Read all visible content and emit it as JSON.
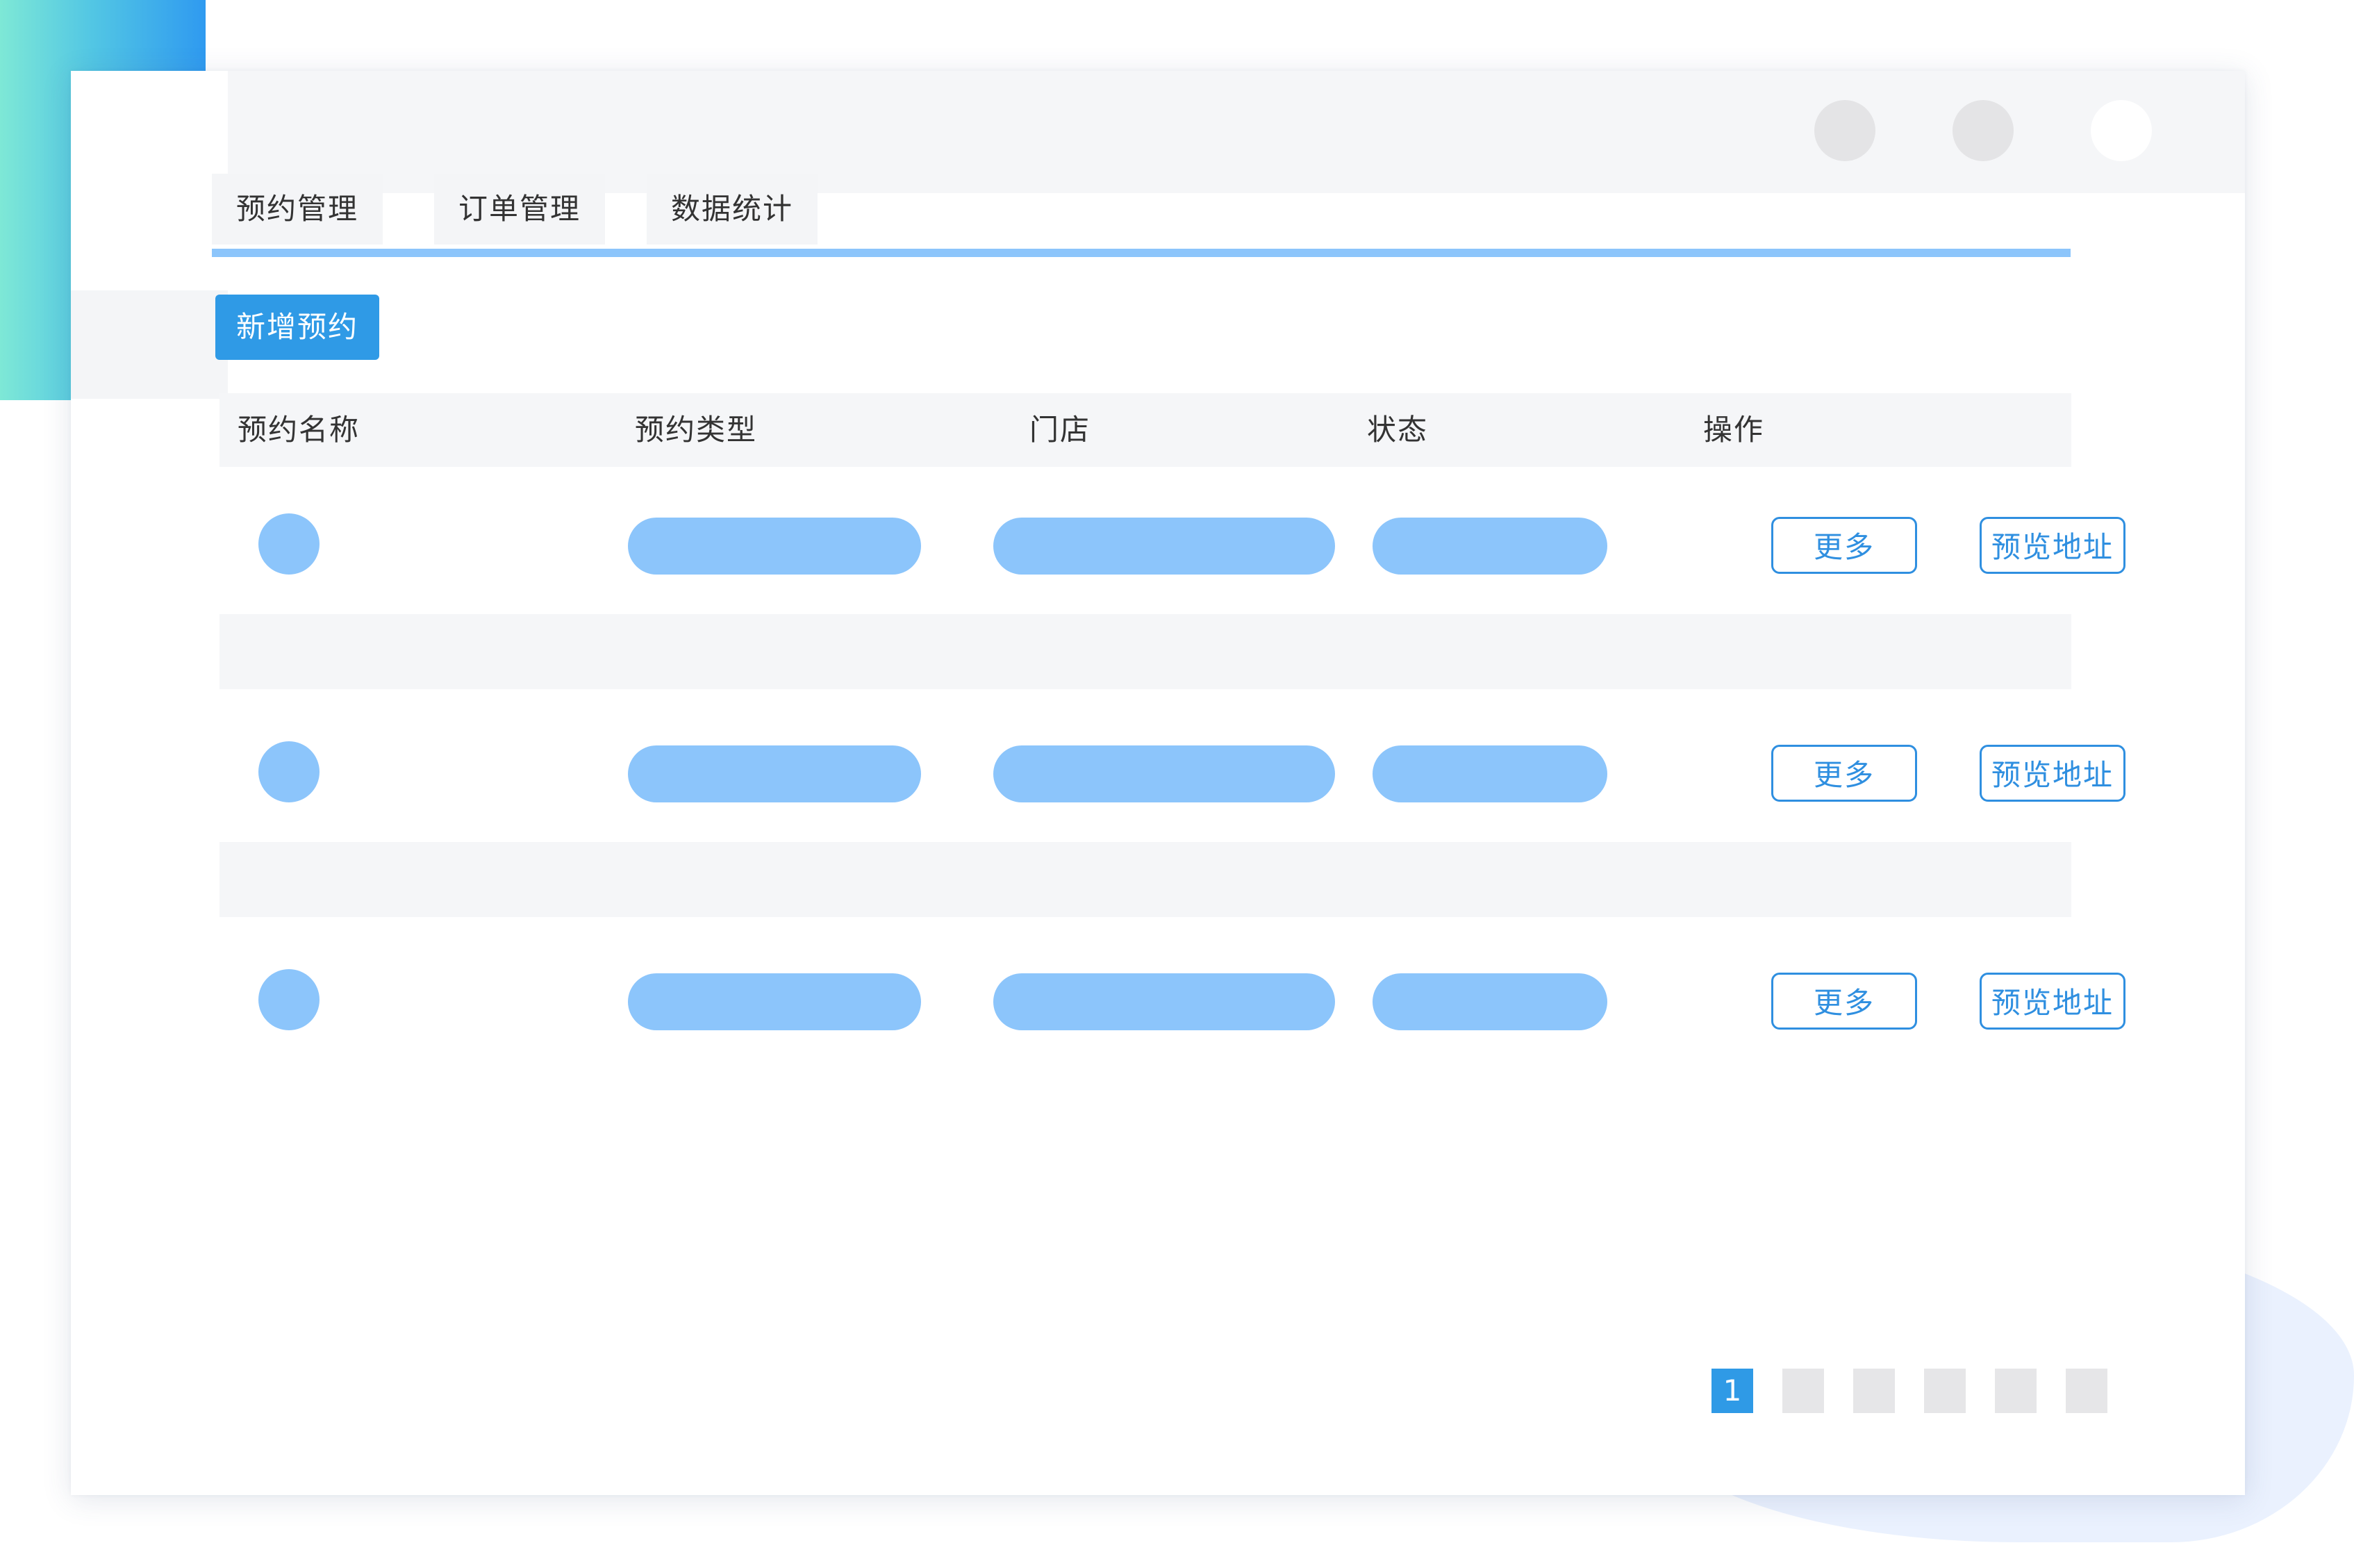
{
  "tabs": [
    {
      "label": "预约管理"
    },
    {
      "label": "订单管理"
    },
    {
      "label": "数据统计"
    }
  ],
  "toolbar": {
    "new_label": "新增预约"
  },
  "table": {
    "columns": [
      "预约名称",
      "预约类型",
      "门店",
      "状态",
      "操作"
    ],
    "rows": [
      {
        "more_label": "更多",
        "preview_label": "预览地址"
      },
      {
        "more_label": "更多",
        "preview_label": "预览地址"
      },
      {
        "more_label": "更多",
        "preview_label": "预览地址"
      }
    ]
  },
  "pagination": {
    "current": "1"
  },
  "colors": {
    "accent": "#2f9ae6",
    "placeholder_blue": "#8cc5fb",
    "header_bg": "#f5f6f8"
  }
}
